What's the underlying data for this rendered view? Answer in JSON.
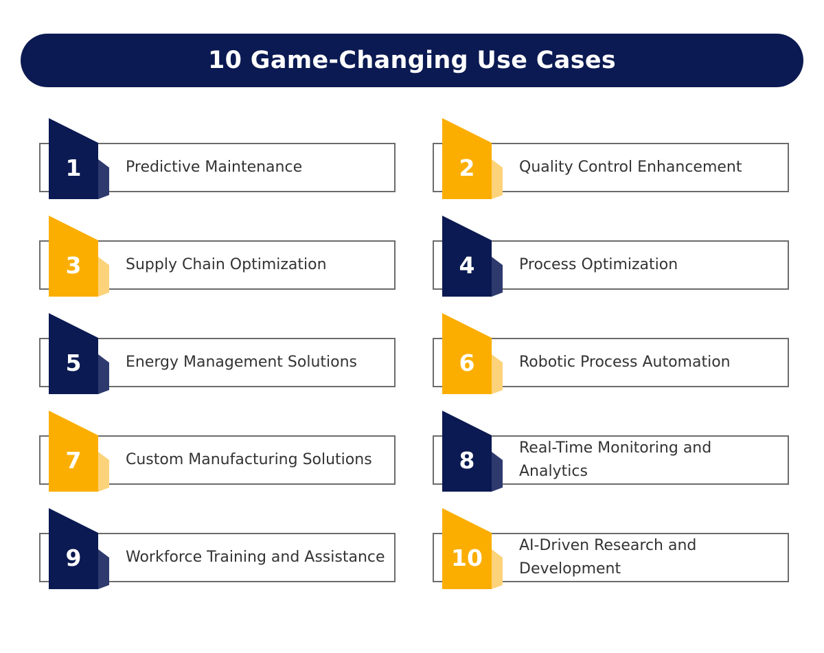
{
  "header": {
    "title": "10 Game-Changing Use Cases"
  },
  "colors": {
    "navy": "#0b1a52",
    "navy_side": "#2e3a6e",
    "amber": "#fbae00",
    "amber_side": "#fcd37a"
  },
  "items": [
    {
      "number": "1",
      "label": "Predictive Maintenance",
      "color": "navy"
    },
    {
      "number": "2",
      "label": "Quality Control Enhancement",
      "color": "amber"
    },
    {
      "number": "3",
      "label": "Supply Chain Optimization",
      "color": "amber"
    },
    {
      "number": "4",
      "label": "Process Optimization",
      "color": "navy"
    },
    {
      "number": "5",
      "label": "Energy Management Solutions",
      "color": "navy"
    },
    {
      "number": "6",
      "label": "Robotic Process Automation",
      "color": "amber"
    },
    {
      "number": "7",
      "label": "Custom Manufacturing Solutions",
      "color": "amber"
    },
    {
      "number": "8",
      "label": "Real-Time Monitoring and Analytics",
      "color": "navy"
    },
    {
      "number": "9",
      "label": "Workforce Training and Assistance",
      "color": "navy"
    },
    {
      "number": "10",
      "label": "AI-Driven Research and Development",
      "color": "amber"
    }
  ]
}
